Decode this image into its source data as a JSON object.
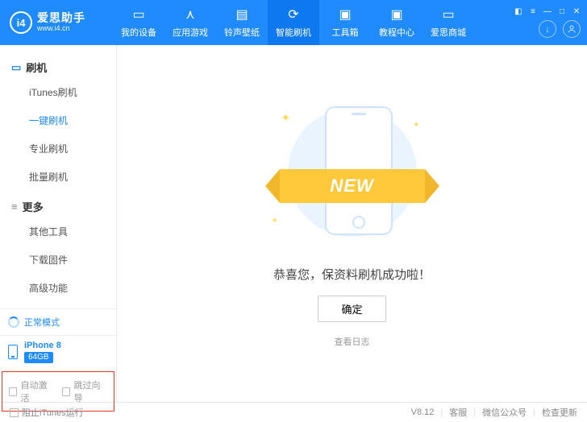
{
  "logo": {
    "badge": "i4",
    "brand": "爱思助手",
    "site": "www.i4.cn"
  },
  "nav": [
    {
      "label": "我的设备",
      "icon": "▭"
    },
    {
      "label": "应用游戏",
      "icon": "⋏"
    },
    {
      "label": "铃声壁纸",
      "icon": "▤"
    },
    {
      "label": "智能刷机",
      "icon": "⟳",
      "active": true
    },
    {
      "label": "工具箱",
      "icon": "▣"
    },
    {
      "label": "教程中心",
      "icon": "▣"
    },
    {
      "label": "爱思商城",
      "icon": "▭"
    }
  ],
  "header_icons": {
    "download": "↓",
    "user": "◯"
  },
  "sidebar": {
    "group1": {
      "title": "刷机",
      "icon": "▭"
    },
    "items1": [
      {
        "label": "iTunes刷机"
      },
      {
        "label": "一键刷机",
        "active": true
      },
      {
        "label": "专业刷机"
      },
      {
        "label": "批量刷机"
      }
    ],
    "group2": {
      "title": "更多",
      "icon": "≡"
    },
    "items2": [
      {
        "label": "其他工具"
      },
      {
        "label": "下载固件"
      },
      {
        "label": "高级功能"
      }
    ]
  },
  "status": {
    "mode": "正常模式"
  },
  "device": {
    "model": "iPhone 8",
    "storage": "64GB"
  },
  "options": {
    "auto_activate": "自动激活",
    "skip_guide": "跳过向导"
  },
  "main": {
    "banner": "NEW",
    "message": "恭喜您，保资料刷机成功啦！",
    "ok": "确定",
    "log": "查看日志"
  },
  "footer": {
    "block_itunes": "阻止iTunes运行",
    "version": "V8.12",
    "support": "客服",
    "wechat": "微信公众号",
    "update": "检查更新"
  }
}
